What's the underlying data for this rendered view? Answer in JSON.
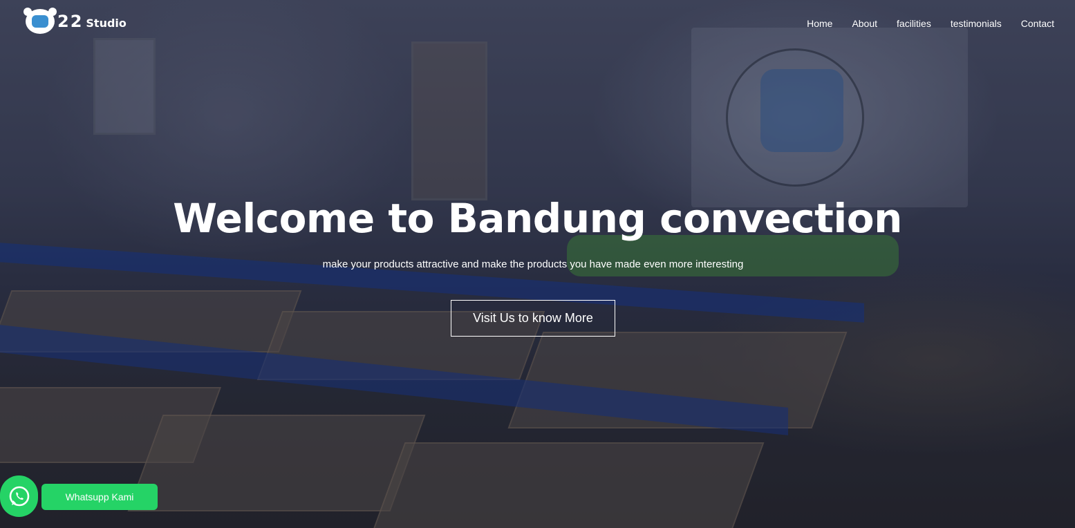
{
  "header": {
    "logo": {
      "number": "22",
      "wordmark": "Studio"
    },
    "nav": [
      "Home",
      "About",
      "facilities",
      "testimonials",
      "Contact"
    ]
  },
  "hero": {
    "title": "Welcome to Bandung convection",
    "subtitle": "make your products attractive and make the products you have made even more interesting",
    "cta_label": "Visit Us to know More"
  },
  "whatsapp": {
    "icon": "whatsapp-icon",
    "label": "Whatsupp Kami",
    "color": "#25d366"
  },
  "colors": {
    "text": "#ffffff",
    "accent_green": "#25d366"
  }
}
